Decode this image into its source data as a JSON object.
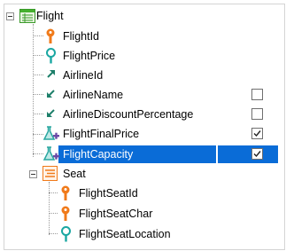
{
  "tree": {
    "root": {
      "label": "Flight",
      "icon": "transaction-table-icon"
    },
    "attributes": [
      {
        "label": "FlightId",
        "icon": "key-icon",
        "checkbox": null
      },
      {
        "label": "FlightPrice",
        "icon": "search-key-icon",
        "checkbox": null
      },
      {
        "label": "AirlineId",
        "icon": "foreign-key-arrow-icon",
        "checkbox": null
      },
      {
        "label": "AirlineName",
        "icon": "inferred-arrow-icon",
        "checkbox": false
      },
      {
        "label": "AirlineDiscountPercentage",
        "icon": "inferred-arrow-icon",
        "checkbox": false
      },
      {
        "label": "FlightFinalPrice",
        "icon": "formula-flask-icon",
        "checkbox": true
      },
      {
        "label": "FlightCapacity",
        "icon": "formula-flask-icon",
        "checkbox": true,
        "selected": true
      }
    ],
    "level": {
      "label": "Seat",
      "icon": "level-icon"
    },
    "level_attributes": [
      {
        "label": "FlightSeatId",
        "icon": "key-icon"
      },
      {
        "label": "FlightSeatChar",
        "icon": "key-icon"
      },
      {
        "label": "FlightSeatLocation",
        "icon": "search-key-icon"
      }
    ]
  },
  "colors": {
    "selection": "#0a6cd7",
    "key": "#f07a1a",
    "search_key": "#1aa7a2",
    "arrow": "#1d7f6a",
    "flask": "#2aa7a0",
    "flask_plus": "#6a4aa6"
  }
}
